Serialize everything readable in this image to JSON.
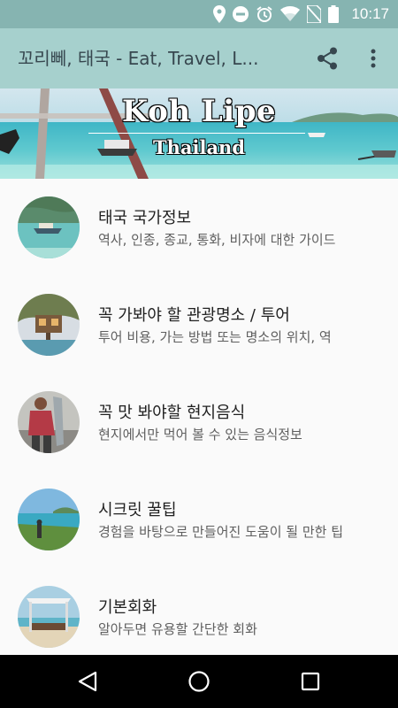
{
  "status_bar": {
    "time": "10:17",
    "icons": [
      "location-icon",
      "do-not-disturb-icon",
      "alarm-icon",
      "wifi-icon",
      "no-sim-icon",
      "battery-icon"
    ]
  },
  "app_bar": {
    "title": "꼬리뻬, 태국 - Eat, Travel, L...",
    "actions": [
      "share-icon",
      "more-vert-icon"
    ]
  },
  "banner": {
    "title": "Koh Lipe",
    "subtitle": "Thailand"
  },
  "items": [
    {
      "title": "태국 국가정보",
      "description": "역사, 인종, 종교, 통화, 비자에 대한 가이드"
    },
    {
      "title": "꼭 가봐야 할 관광명소 / 투어",
      "description": "투어 비용, 가는 방법 또는 명소의 위치, 역"
    },
    {
      "title": "꼭 맛 봐야할 현지음식",
      "description": "현지에서만 먹어 볼 수 있는 음식정보"
    },
    {
      "title": "시크릿 꿀팁",
      "description": "경험을 바탕으로 만들어진 도움이 될 만한 팁"
    },
    {
      "title": "기본회화",
      "description": "알아두면 유용할 간단한 회화"
    }
  ],
  "nav_bar": {
    "buttons": [
      "back-icon",
      "home-icon",
      "recents-icon"
    ]
  },
  "colors": {
    "status_bar": "#86b4b1",
    "app_bar": "#a6d0cd",
    "background": "#fafafa",
    "nav_bar": "#000000"
  }
}
